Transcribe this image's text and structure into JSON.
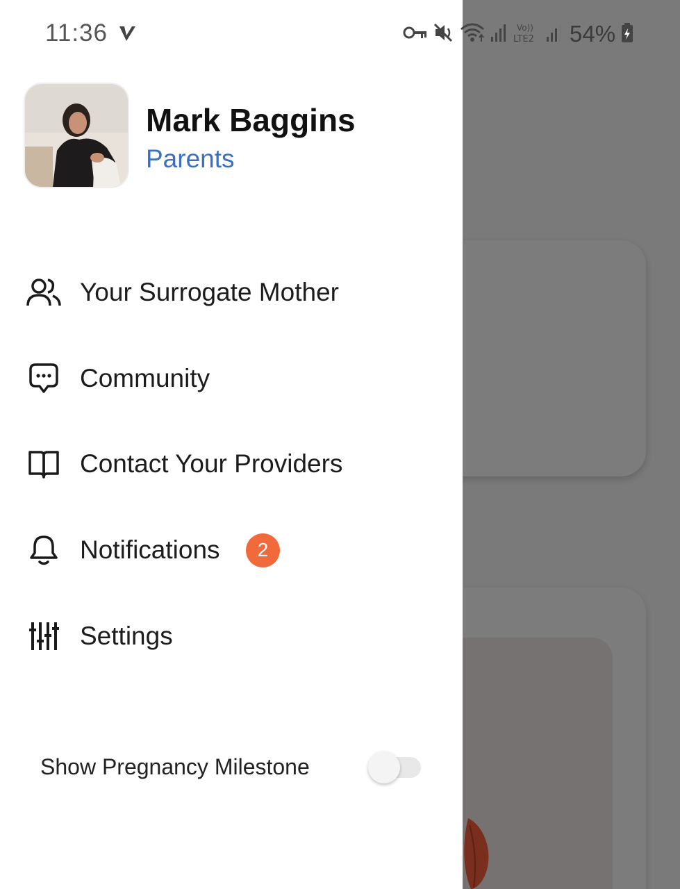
{
  "status_bar": {
    "time": "11:36",
    "battery_percent": "54%",
    "icons": [
      "v-icon",
      "vpn-key-icon",
      "mute-icon",
      "wifi-icon",
      "signal-icon",
      "volte-lte2-icon",
      "signal-icon",
      "battery-icon"
    ]
  },
  "profile": {
    "name": "Mark Baggins",
    "role": "Parents"
  },
  "menu": {
    "items": [
      {
        "label": "Your Surrogate Mother",
        "icon": "people-icon"
      },
      {
        "label": "Community",
        "icon": "chat-bubble-icon"
      },
      {
        "label": "Contact Your Providers",
        "icon": "book-icon"
      },
      {
        "label": "Notifications",
        "icon": "bell-icon",
        "badge": "2"
      },
      {
        "label": "Settings",
        "icon": "sliders-icon"
      }
    ]
  },
  "milestone_toggle": {
    "label": "Show Pregnancy Milestone",
    "enabled": false
  },
  "colors": {
    "accent_blue": "#3a6fc4",
    "badge_orange": "#f06a3c",
    "overlay_gray": "#7a7a7a"
  }
}
